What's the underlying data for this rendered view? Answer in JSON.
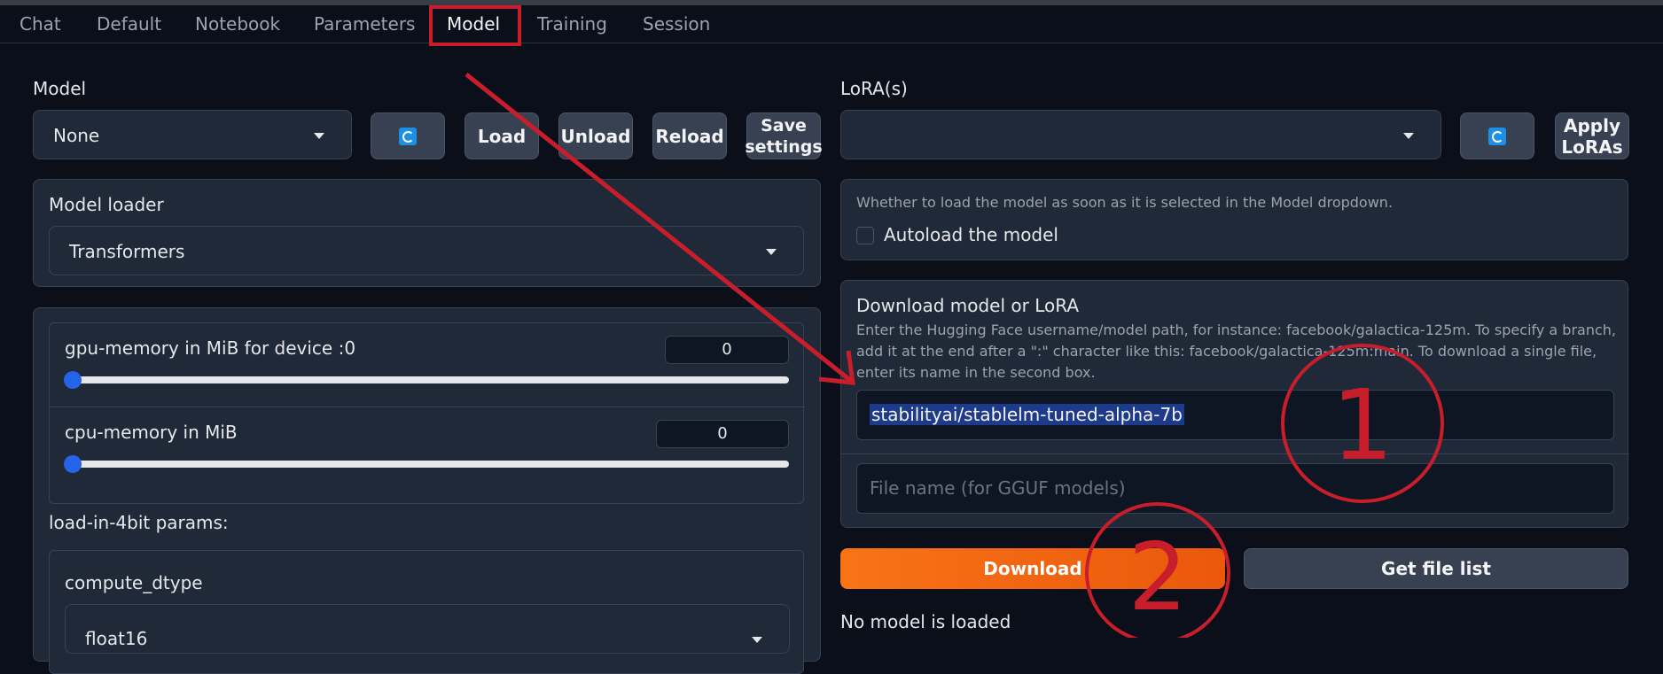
{
  "tabs": [
    "Chat",
    "Default",
    "Notebook",
    "Parameters",
    "Model",
    "Training",
    "Session"
  ],
  "active_tab": "Model",
  "model": {
    "label": "Model",
    "selected": "None",
    "buttons": {
      "load": "Load",
      "unload": "Unload",
      "reload": "Reload",
      "save": "Save settings"
    }
  },
  "loader": {
    "label": "Model loader",
    "selected": "Transformers"
  },
  "memory": {
    "gpu_label": "gpu-memory in MiB for device :0",
    "gpu_value": "0",
    "cpu_label": "cpu-memory in MiB",
    "cpu_value": "0"
  },
  "fourbit": {
    "label": "load-in-4bit params:",
    "compute_label": "compute_dtype",
    "compute_value": "float16"
  },
  "lora": {
    "label": "LoRA(s)",
    "selected": "",
    "apply": "Apply LoRAs"
  },
  "autoload": {
    "info": "Whether to load the model as soon as it is selected in the Model dropdown.",
    "label": "Autoload the model"
  },
  "download": {
    "title": "Download model or LoRA",
    "info": "Enter the Hugging Face username/model path, for instance: facebook/galactica-125m. To specify a branch, add it at the end after a \":\" character like this: facebook/galactica-125m:main. To download a single file, enter its name in the second box.",
    "path_value": "stabilityai/stablelm-tuned-alpha-7b",
    "file_placeholder": "File name (for GGUF models)",
    "download_button": "Download",
    "file_list_button": "Get file list"
  },
  "status": "No model is loaded",
  "annotations": {
    "one": "1",
    "two": "2"
  },
  "colors": {
    "accent_orange": "#f97316",
    "annotation_red": "#c81e2c",
    "slider_blue": "#2563eb"
  }
}
